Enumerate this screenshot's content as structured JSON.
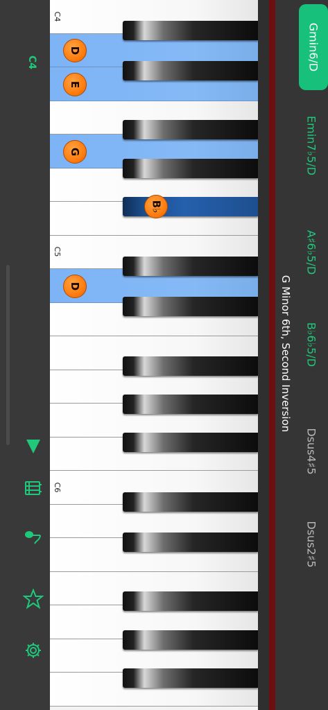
{
  "left_panel": {
    "octave_label": "C4",
    "tools": [
      {
        "name": "play-triangle-icon"
      },
      {
        "name": "keyboard-icon"
      },
      {
        "name": "music-note-icon"
      },
      {
        "name": "star-icon"
      },
      {
        "name": "gear-icon"
      }
    ]
  },
  "keyboard": {
    "key_labels": {
      "c4": "C4",
      "c5": "C5",
      "c6": "C6"
    },
    "notes": [
      "D",
      "E",
      "G",
      "B♭",
      "D"
    ]
  },
  "chord": {
    "title": "G Minor 6th, Second Inversion",
    "options": [
      {
        "label": "Gmin6/D",
        "selected": true
      },
      {
        "label": "Emin7♭5/D",
        "selected": false
      },
      {
        "label": "A♯6♭5/D",
        "selected": false
      },
      {
        "label": "B♭6♭5/D",
        "selected": false
      },
      {
        "label": "Dsus4♯5",
        "selected": false
      },
      {
        "label": "Dsus2♯5",
        "selected": false
      }
    ]
  },
  "colors": {
    "accent": "#1fc87a",
    "selected_chord_bg": "#17c07b",
    "active_white_key": "#85b9f6",
    "active_black_key": "#2560ad",
    "note_badge": "#ff7d10"
  }
}
